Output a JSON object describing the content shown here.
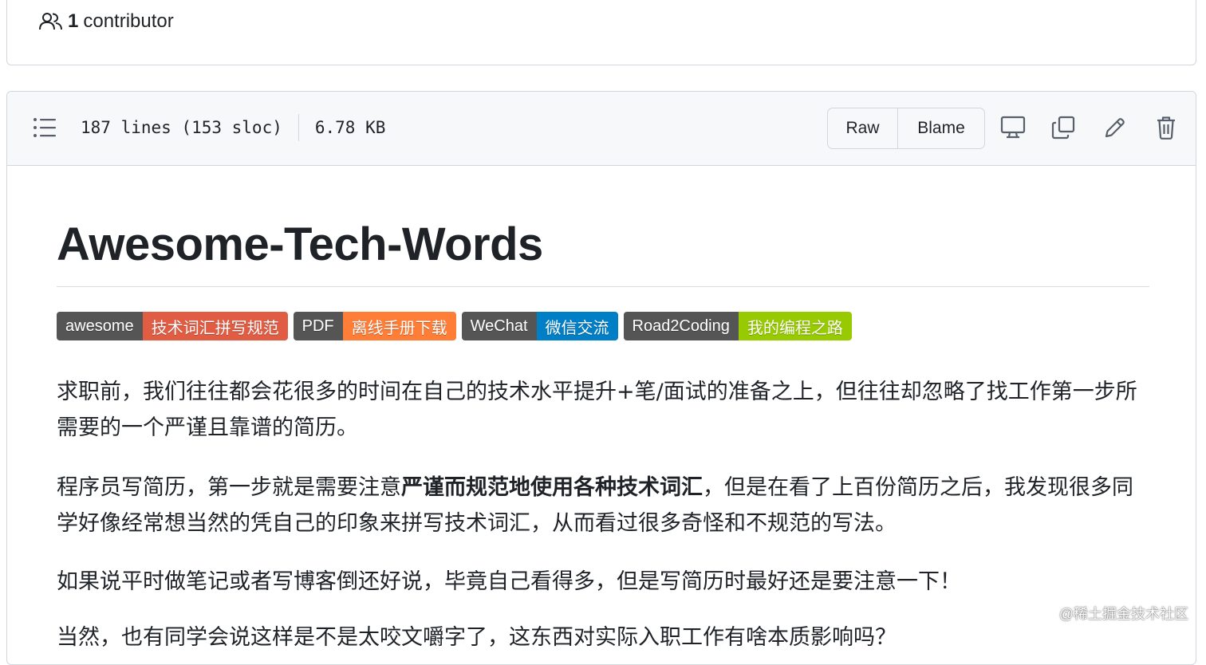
{
  "contributors": {
    "count": "1",
    "label": "contributor"
  },
  "file_header": {
    "lines": "187 lines (153 sloc)",
    "size": "6.78 KB",
    "raw_label": "Raw",
    "blame_label": "Blame",
    "icons": [
      "list-unordered-icon",
      "device-desktop-icon",
      "copy-icon",
      "pencil-icon",
      "trash-icon"
    ]
  },
  "readme": {
    "title": "Awesome-Tech-Words",
    "badges": [
      {
        "label": "awesome",
        "message": "技术词汇拼写规范",
        "color": "#e05d44"
      },
      {
        "label": "PDF",
        "message": "离线手册下载",
        "color": "#fe7d37"
      },
      {
        "label": "WeChat",
        "message": "微信交流",
        "color": "#007ec6"
      },
      {
        "label": "Road2Coding",
        "message": "我的编程之路",
        "color": "#97ca00"
      }
    ],
    "paragraphs": {
      "p1": "求职前，我们往往都会花很多的时间在自己的技术水平提升+笔/面试的准备之上，但往往却忽略了找工作第一步所需要的一个严谨且靠谱的简历。",
      "p2_before": "程序员写简历，第一步就是需要注意",
      "p2_bold": "严谨而规范地使用各种技术词汇",
      "p2_after": "，但是在看了上百份简历之后，我发现很多同学好像经常想当然的凭自己的印象来拼写技术词汇，从而看过很多奇怪和不规范的写法。",
      "p3": "如果说平时做笔记或者写博客倒还好说，毕竟自己看得多，但是写简历时最好还是要注意一下！",
      "p4": "当然，也有同学会说这样是不是太咬文嚼字了，这东西对实际入职工作有啥本质影响吗？"
    }
  },
  "watermark": "@稀土掘金技术社区",
  "colors": {
    "border": "#d0d7de",
    "header_bg": "#f6f8fa",
    "text": "#1f2328",
    "badge_label_bg": "#555555"
  }
}
